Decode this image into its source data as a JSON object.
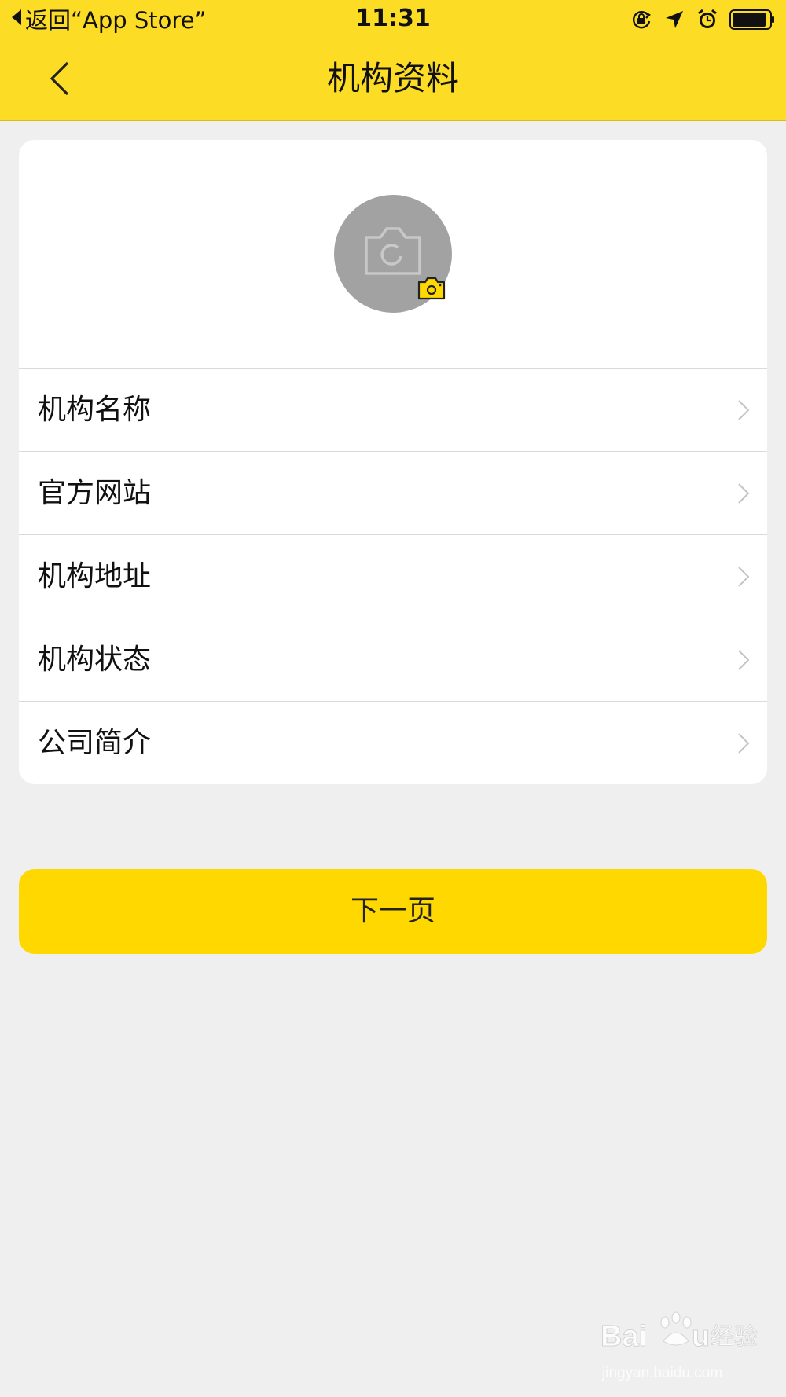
{
  "status_bar": {
    "back_label": "返回“App Store”",
    "time": "11:31"
  },
  "nav": {
    "title": "机构资料"
  },
  "list": {
    "items": [
      {
        "label": "机构名称"
      },
      {
        "label": "官方网站"
      },
      {
        "label": "机构地址"
      },
      {
        "label": "机构状态"
      },
      {
        "label": "公司简介"
      }
    ]
  },
  "next_button": {
    "label": "下一页"
  },
  "watermark": {
    "logo": "Baidu经验",
    "url": "jingyan.baidu.com"
  },
  "colors": {
    "header": "#fddc25",
    "button": "#ffd800",
    "background": "#efefef",
    "avatar": "#a2a2a2"
  },
  "icons": {
    "status": [
      "rotation-lock-icon",
      "location-arrow-icon",
      "alarm-icon",
      "battery-icon"
    ],
    "avatar": [
      "camera-icon",
      "camera-badge-icon"
    ],
    "rows": "chevron-right-icon"
  }
}
